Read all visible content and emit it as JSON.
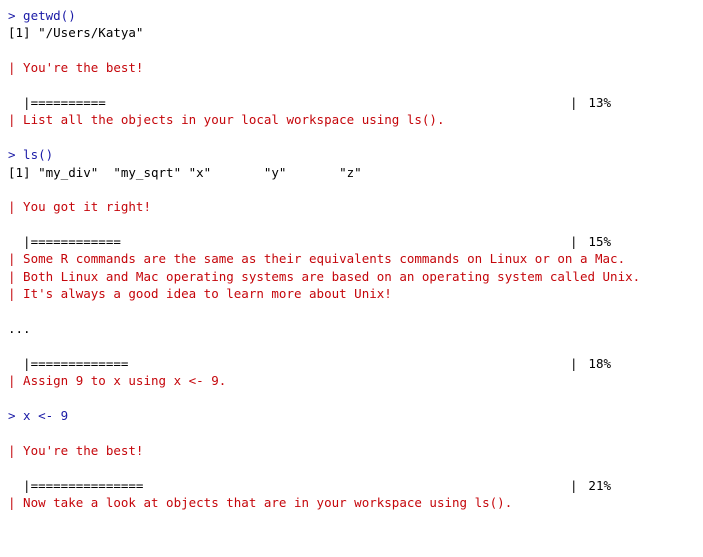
{
  "lines": [
    {
      "type": "prompt",
      "text": "> getwd()"
    },
    {
      "type": "output",
      "text": "[1] \"/Users/Katya\""
    },
    {
      "type": "blank",
      "text": ""
    },
    {
      "type": "swirl",
      "text": "| You're the best!"
    },
    {
      "type": "blank",
      "text": ""
    },
    {
      "type": "progress",
      "bar": "  |==========",
      "end": "|",
      "pct": "13%"
    },
    {
      "type": "swirl",
      "text": "| List all the objects in your local workspace using ls()."
    },
    {
      "type": "blank",
      "text": ""
    },
    {
      "type": "prompt",
      "text": "> ls()"
    },
    {
      "type": "output",
      "text": "[1] \"my_div\"  \"my_sqrt\" \"x\"       \"y\"       \"z\""
    },
    {
      "type": "blank",
      "text": ""
    },
    {
      "type": "swirl",
      "text": "| You got it right!"
    },
    {
      "type": "blank",
      "text": ""
    },
    {
      "type": "progress",
      "bar": "  |============",
      "end": "|",
      "pct": "15%"
    },
    {
      "type": "swirl",
      "text": "| Some R commands are the same as their equivalents commands on Linux or on a Mac."
    },
    {
      "type": "swirl",
      "text": "| Both Linux and Mac operating systems are based on an operating system called Unix."
    },
    {
      "type": "swirl",
      "text": "| It's always a good idea to learn more about Unix!"
    },
    {
      "type": "blank",
      "text": ""
    },
    {
      "type": "output",
      "text": "..."
    },
    {
      "type": "blank",
      "text": ""
    },
    {
      "type": "progress",
      "bar": "  |=============",
      "end": "|",
      "pct": "18%"
    },
    {
      "type": "swirl",
      "text": "| Assign 9 to x using x <- 9."
    },
    {
      "type": "blank",
      "text": ""
    },
    {
      "type": "prompt",
      "text": "> x <- 9"
    },
    {
      "type": "blank",
      "text": ""
    },
    {
      "type": "swirl",
      "text": "| You're the best!"
    },
    {
      "type": "blank",
      "text": ""
    },
    {
      "type": "progress",
      "bar": "  |===============",
      "end": "|",
      "pct": "21%"
    },
    {
      "type": "swirl",
      "text": "| Now take a look at objects that are in your workspace using ls()."
    }
  ]
}
